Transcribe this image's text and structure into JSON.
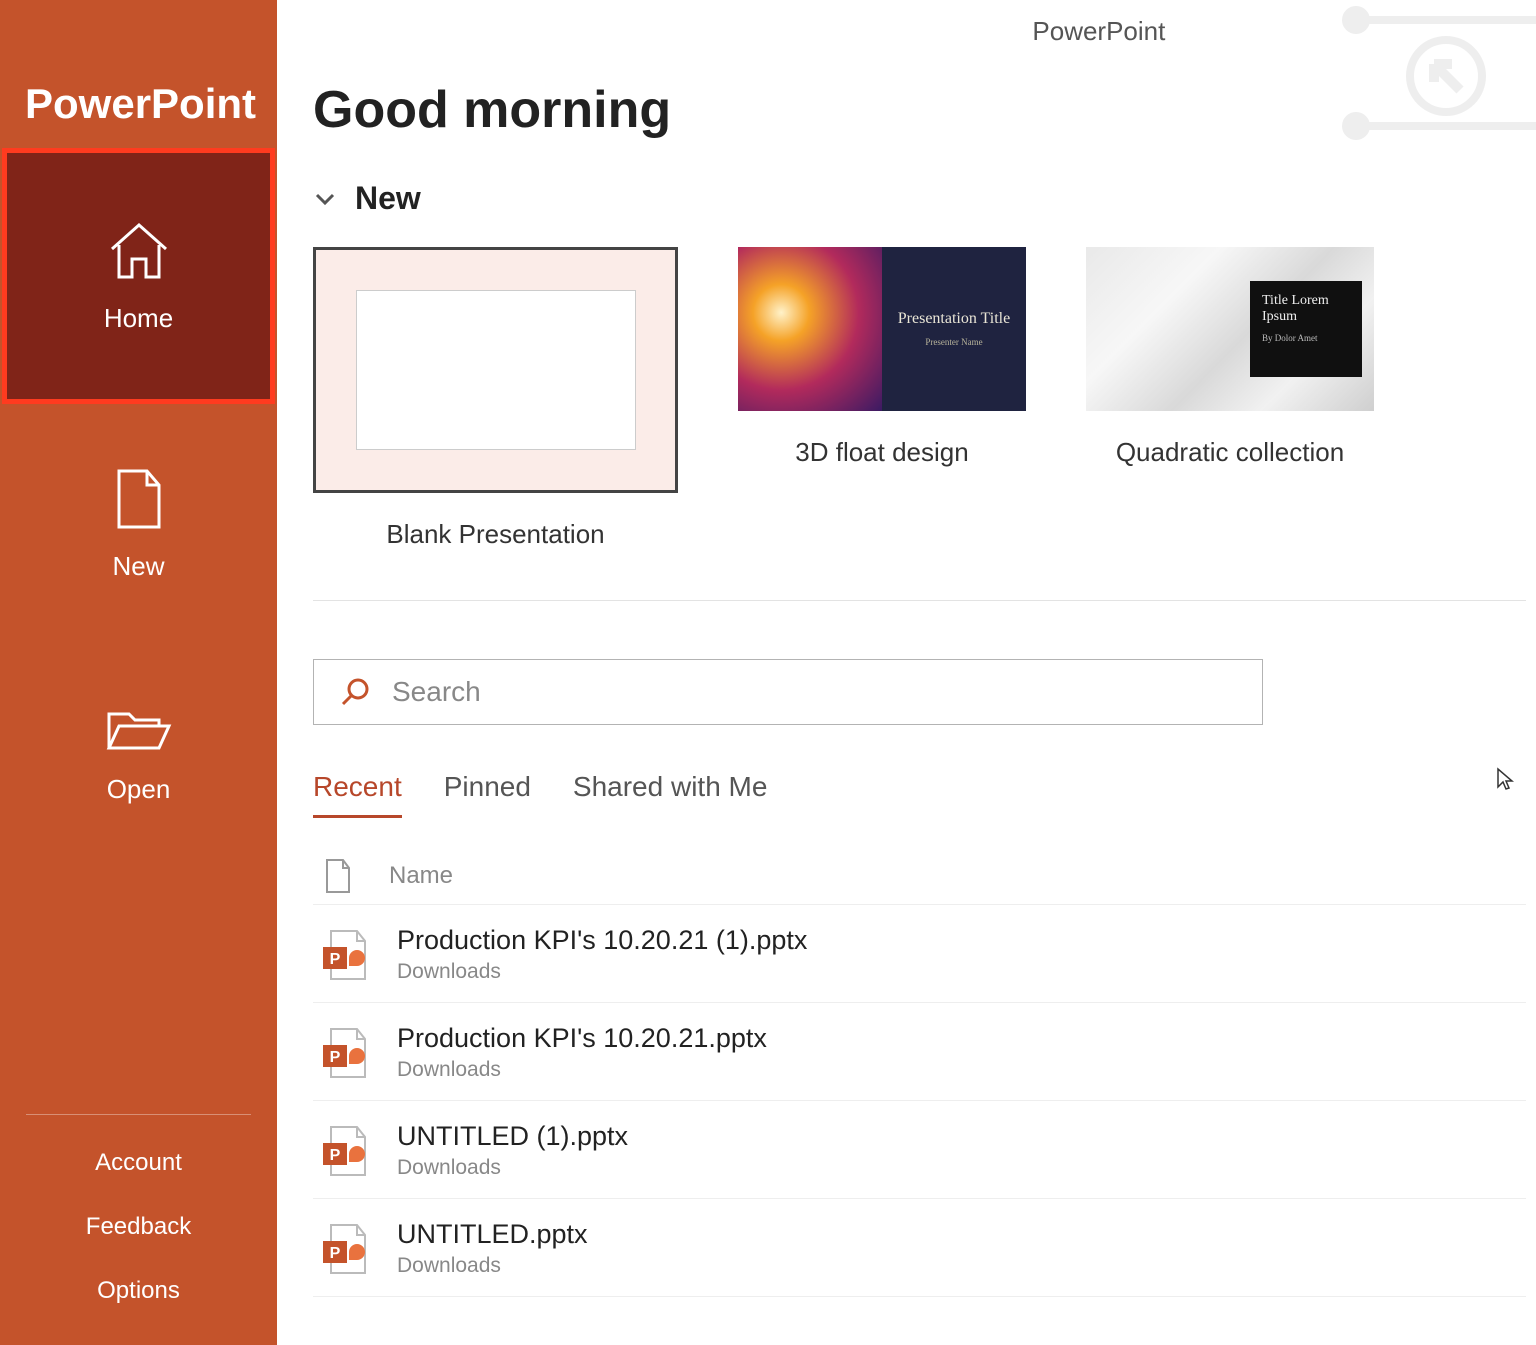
{
  "app": {
    "name": "PowerPoint",
    "header_label": "PowerPoint"
  },
  "sidebar": {
    "items": [
      {
        "label": "Home"
      },
      {
        "label": "New"
      },
      {
        "label": "Open"
      }
    ],
    "bottom": [
      {
        "label": "Account"
      },
      {
        "label": "Feedback"
      },
      {
        "label": "Options"
      }
    ]
  },
  "greeting": "Good morning",
  "sections": {
    "new_label": "New"
  },
  "templates": [
    {
      "label": "Blank Presentation",
      "selected": true
    },
    {
      "label": "3D float design",
      "thumb_title": "Presentation Title",
      "thumb_sub": "Presenter Name"
    },
    {
      "label": "Quadratic collection",
      "thumb_title": "Title Lorem Ipsum",
      "thumb_sub": "By Dolor Amet"
    }
  ],
  "search": {
    "placeholder": "Search"
  },
  "tabs": [
    {
      "label": "Recent",
      "active": true
    },
    {
      "label": "Pinned"
    },
    {
      "label": "Shared with Me"
    }
  ],
  "list_header": {
    "name_col": "Name"
  },
  "files": [
    {
      "name": "Production KPI's 10.20.21 (1).pptx",
      "location": "Downloads"
    },
    {
      "name": "Production KPI's 10.20.21.pptx",
      "location": "Downloads"
    },
    {
      "name": "UNTITLED (1).pptx",
      "location": "Downloads"
    },
    {
      "name": "UNTITLED.pptx",
      "location": "Downloads"
    }
  ]
}
